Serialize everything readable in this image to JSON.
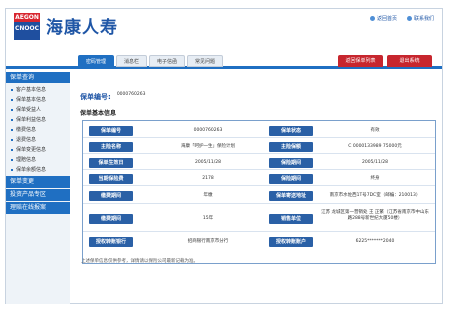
{
  "header": {
    "logo_top": "AEGON",
    "logo_bottom": "CNOOC",
    "brand": "海康人寿",
    "links": [
      "返回首页",
      "联系我们"
    ]
  },
  "nav": {
    "tabs": [
      "密码管理",
      "消息栏",
      "电子信函",
      "常见问题"
    ],
    "active_tab": "密码管理",
    "right_buttons": [
      "返回保单列表",
      "退出系统"
    ]
  },
  "sidebar": {
    "section1": "保单查询",
    "items": [
      "客户基本信息",
      "保单基本信息",
      "保单受益人",
      "保单利益信息",
      "缴费信息",
      "退费信息",
      "保单变更信息",
      "理赔信息",
      "保单余额信息"
    ],
    "section2": "保单变更",
    "section3": "投资产品专区",
    "section4": "理赔在线报案"
  },
  "main": {
    "policy_label": "保单编号:",
    "policy_value": "0000760263",
    "section_title": "保单基本信息",
    "rows": [
      {
        "l1": "保单编号",
        "v1": "0000760263",
        "l2": "保单状态",
        "v2": "有效"
      },
      {
        "l1": "主险名称",
        "v1": "海康「呵护一生」保险计划",
        "l2": "主险保额",
        "v2": "C 0000133989 75000元"
      },
      {
        "l1": "保单生效日",
        "v1": "2005/11/28",
        "l2": "保险期间",
        "v2": "2005/11/28"
      },
      {
        "l1": "当期保险费",
        "v1": "2178",
        "l2": "保险期间",
        "v2": "终身"
      },
      {
        "l1": "缴费期间",
        "v1": "年缴",
        "l2": "保单寄送地址",
        "v2": "南京市水佐西1T号7DC室（邮编：210013）"
      },
      {
        "l1": "缴费期间",
        "v1": "15年",
        "l2": "销售单位",
        "v2": "江苏 龙城区第一营销处 王 正繁（江苏省南京市中山东路288号新世纪大厦50楼）"
      },
      {
        "l1": "授权转账银行",
        "v1": "招商银行南京市分行",
        "l2": "授权转账账户",
        "v2": "6225*******2040"
      }
    ],
    "footnote": "上述保单信息仅供参考，详情请以保险公司最新记载为准。"
  }
}
